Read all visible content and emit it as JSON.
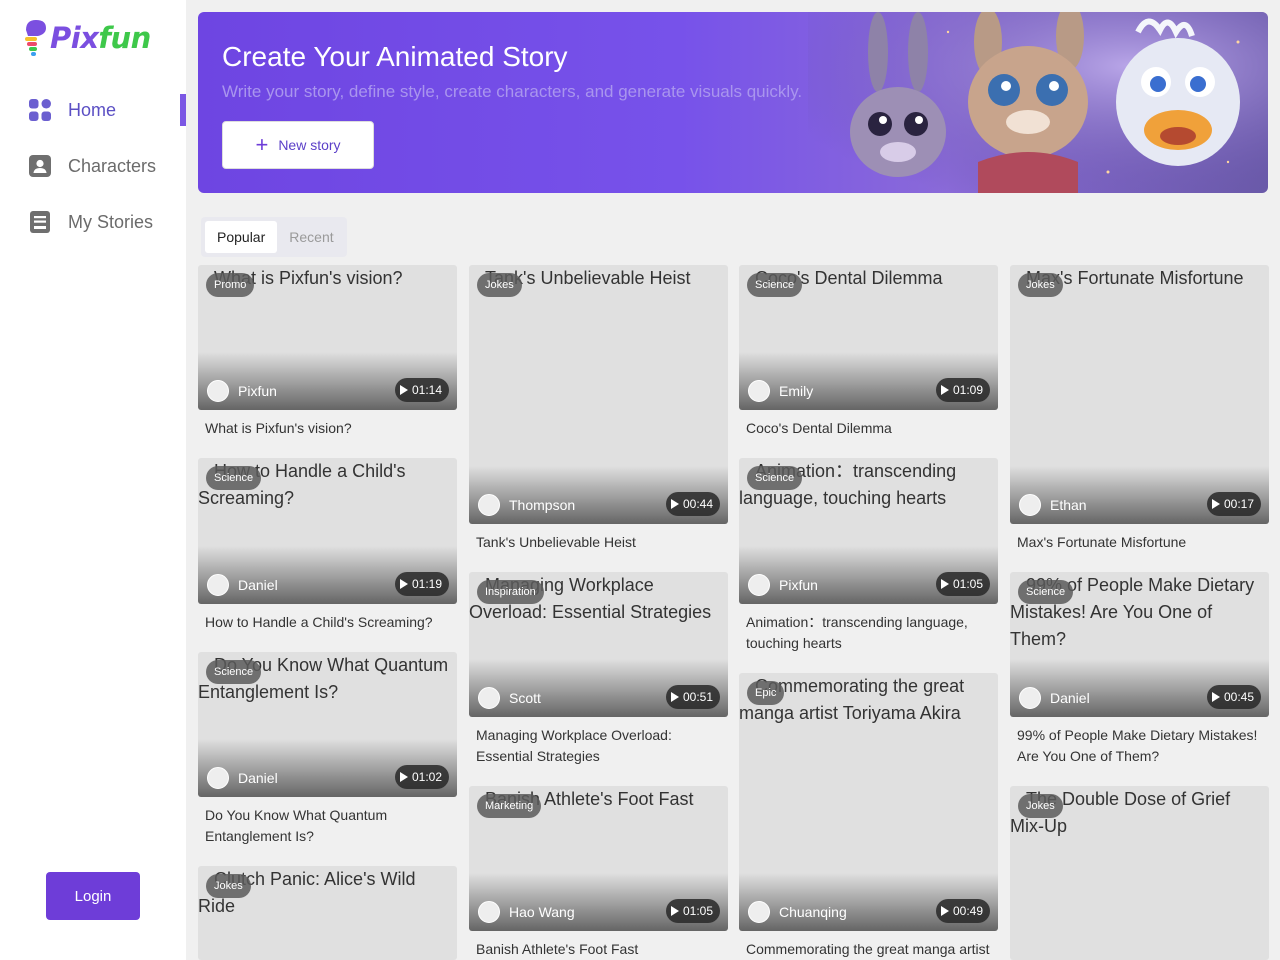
{
  "app": {
    "logo_part1": "Pix",
    "logo_part2": "fun"
  },
  "sidebar": {
    "items": [
      {
        "label": "Home",
        "icon": "grid-icon",
        "active": true
      },
      {
        "label": "Characters",
        "icon": "character-icon",
        "active": false
      },
      {
        "label": "My Stories",
        "icon": "book-icon",
        "active": false
      }
    ],
    "login_label": "Login"
  },
  "banner": {
    "title": "Create Your Animated Story",
    "subtitle": "Write your story, define style, create characters, and generate visuals quickly.",
    "button_label": "New story"
  },
  "tabs": [
    {
      "label": "Popular",
      "active": true
    },
    {
      "label": "Recent",
      "active": false
    }
  ],
  "cards": [
    {
      "tag": "Promo",
      "alt": "What is Pixfun's vision?",
      "author": "Pixfun",
      "duration": "01:14",
      "title": "What is Pixfun's vision?"
    },
    {
      "tag": "Jokes",
      "alt": "Tank's Unbelievable Heist",
      "author": "Thompson",
      "duration": "00:44",
      "title": "Tank's Unbelievable Heist"
    },
    {
      "tag": "Science",
      "alt": "Coco's Dental Dilemma",
      "author": "Emily",
      "duration": "01:09",
      "title": "Coco's Dental Dilemma"
    },
    {
      "tag": "Jokes",
      "alt": "Max's Fortunate Misfortune",
      "author": "Ethan",
      "duration": "00:17",
      "title": "Max's Fortunate Misfortune"
    },
    {
      "tag": "Science",
      "alt": "How to Handle a Child's Screaming?",
      "author": "Daniel",
      "duration": "01:19",
      "title": "How to Handle a Child's Screaming?"
    },
    {
      "tag": "Science",
      "alt": "Animation：transcending language, touching hearts",
      "author": "Pixfun",
      "duration": "01:05",
      "title": "Animation：transcending language, touching hearts"
    },
    {
      "tag": "Inspiration",
      "alt": "Managing Workplace Overload: Essential Strategies",
      "author": "Scott",
      "duration": "00:51",
      "title": "Managing Workplace Overload: Essential Strategies"
    },
    {
      "tag": "Science",
      "alt": "99% of People Make Dietary Mistakes! Are You One of Them?",
      "author": "Daniel",
      "duration": "00:45",
      "title": "99% of People Make Dietary Mistakes! Are You One of Them?"
    },
    {
      "tag": "Science",
      "alt": "Do You Know What Quantum Entanglement Is?",
      "author": "Daniel",
      "duration": "01:02",
      "title": "Do You Know What Quantum Entanglement Is?"
    },
    {
      "tag": "Epic",
      "alt": "Commemorating the great manga artist Toriyama Akira",
      "author": "Chuanqing",
      "duration": "00:49",
      "title": "Commemorating the great manga artist"
    },
    {
      "tag": "Marketing",
      "alt": "Banish Athlete's Foot Fast",
      "author": "Hao Wang",
      "duration": "01:05",
      "title": "Banish Athlete's Foot Fast"
    },
    {
      "tag": "Jokes",
      "alt": "The Double Dose of Grief Mix-Up",
      "author": "",
      "duration": "",
      "title": ""
    },
    {
      "tag": "Jokes",
      "alt": "Clutch Panic: Alice's Wild Ride",
      "author": "",
      "duration": "",
      "title": ""
    }
  ],
  "colors": {
    "accent": "#6e3dd8",
    "active_nav": "#5b4fc4",
    "banner_start": "#6e45e2"
  }
}
